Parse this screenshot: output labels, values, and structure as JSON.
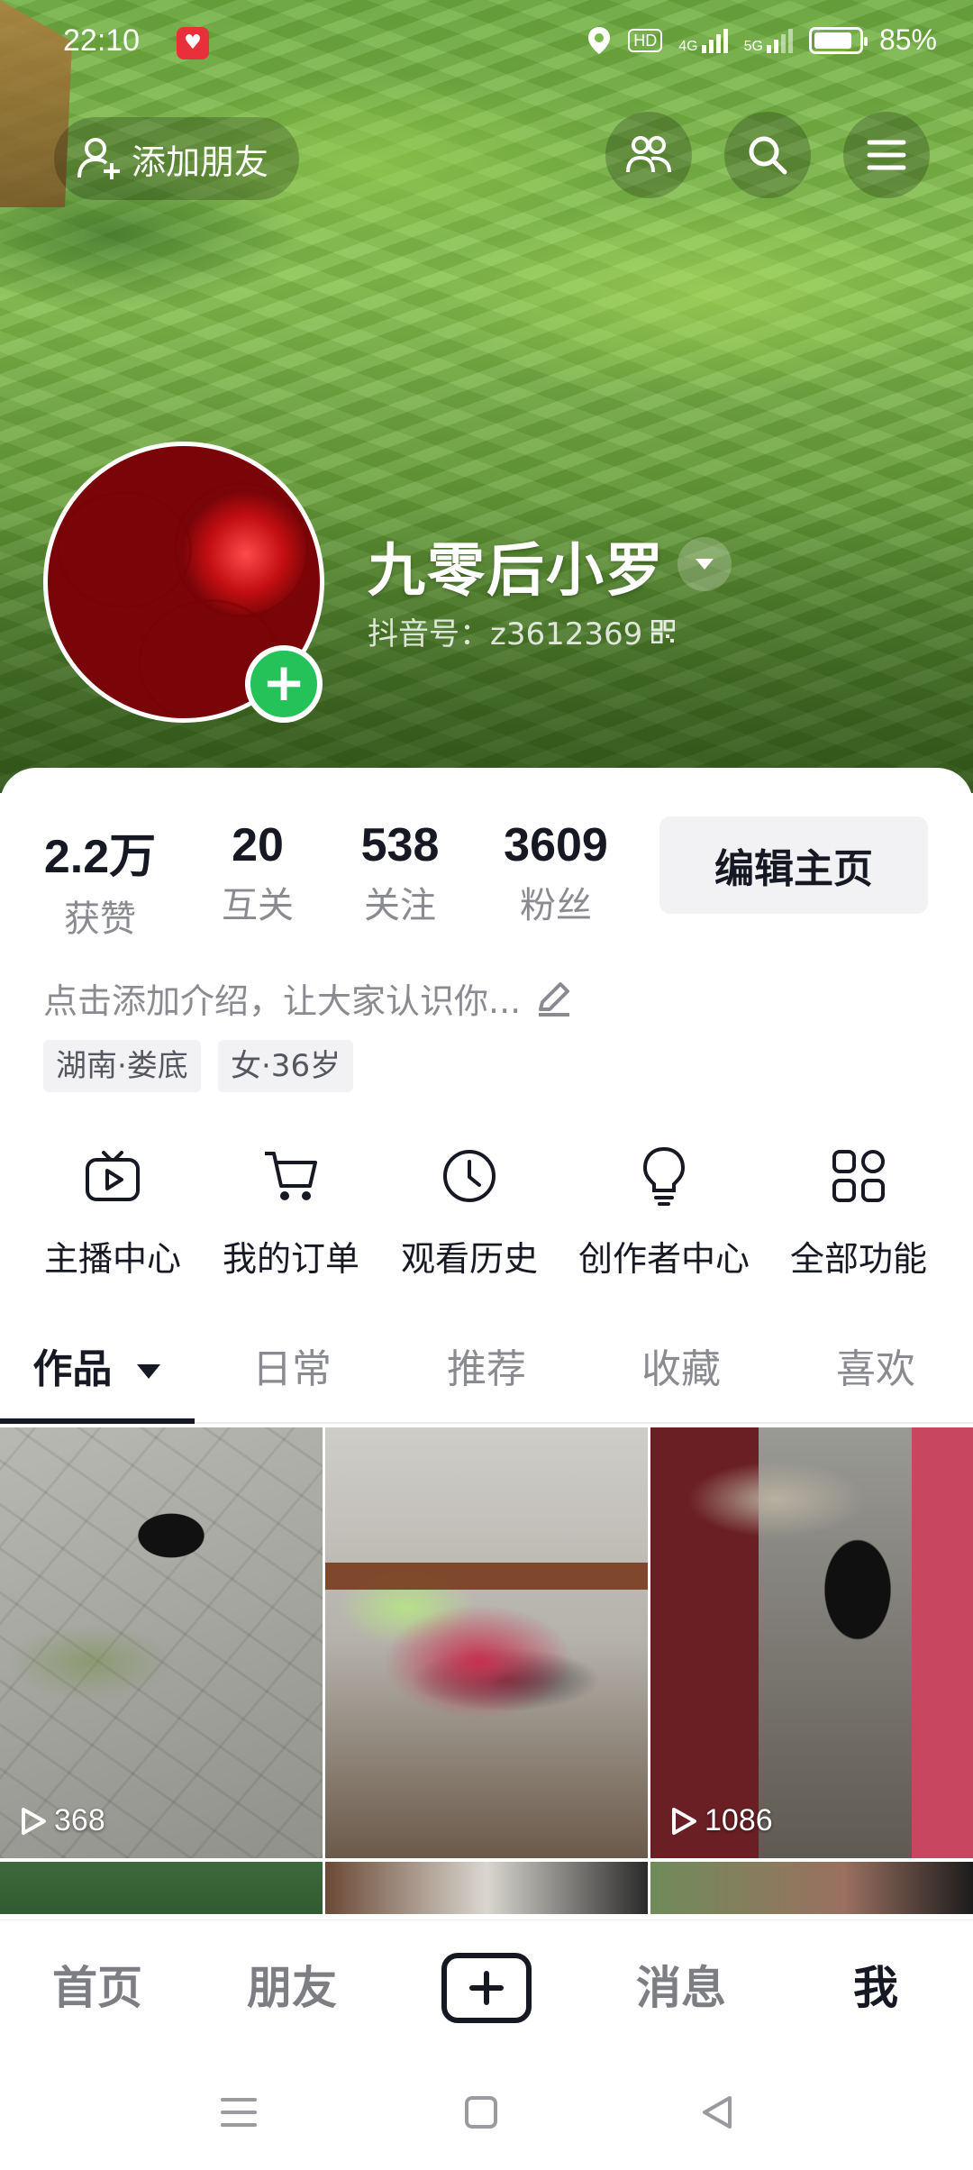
{
  "status_bar": {
    "time": "22:10",
    "hd_label": "HD",
    "net1": "4G",
    "net2": "5G",
    "battery_percent": "85%",
    "battery_level": 0.85
  },
  "header": {
    "add_friend_label": "添加朋友"
  },
  "profile": {
    "name": "九零后小罗",
    "douyin_id": "抖音号：z3612369"
  },
  "stats": [
    {
      "value": "2.2万",
      "label": "获赞"
    },
    {
      "value": "20",
      "label": "互关"
    },
    {
      "value": "538",
      "label": "关注"
    },
    {
      "value": "3609",
      "label": "粉丝"
    }
  ],
  "edit_profile_label": "编辑主页",
  "bio_placeholder": "点击添加介绍，让大家认识你...",
  "tags": [
    "湖南·娄底",
    "女·36岁"
  ],
  "shortcuts": [
    {
      "label": "主播中心",
      "icon": "tv-icon"
    },
    {
      "label": "我的订单",
      "icon": "cart-icon"
    },
    {
      "label": "观看历史",
      "icon": "clock-icon"
    },
    {
      "label": "创作者中心",
      "icon": "lightbulb-icon"
    },
    {
      "label": "全部功能",
      "icon": "grid-icon"
    }
  ],
  "tabs": [
    "作品",
    "日常",
    "推荐",
    "收藏",
    "喜欢"
  ],
  "videos": [
    {
      "play_count": "368"
    },
    {
      "play_count": ""
    },
    {
      "play_count": "1086"
    }
  ],
  "bottom_nav": {
    "home": "首页",
    "friends": "朋友",
    "messages": "消息",
    "me": "我"
  },
  "colors": {
    "accent_green": "#25c25a",
    "text_primary": "#161823",
    "text_secondary": "#8a8b91"
  }
}
